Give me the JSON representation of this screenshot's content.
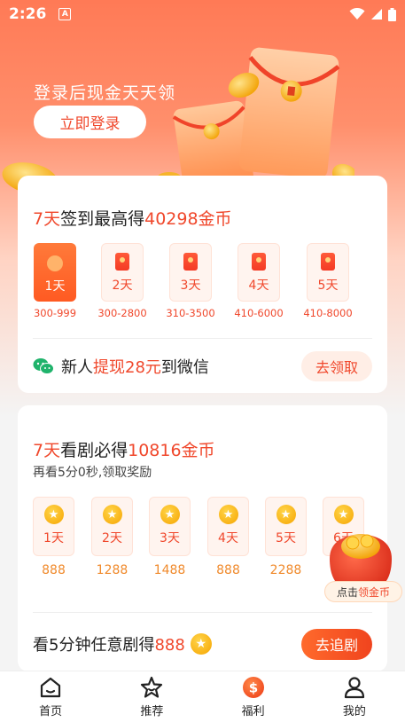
{
  "status": {
    "time": "2:26",
    "a_badge": "A"
  },
  "hero": {
    "text": "登录后现金天天领",
    "login_button": "立即登录"
  },
  "checkin": {
    "title_prefix": "7天",
    "title_mid": "签到最高得",
    "title_value": "40298金币",
    "days": [
      {
        "label": "1天",
        "range": "300-999",
        "active": true
      },
      {
        "label": "2天",
        "range": "300-2800",
        "active": false
      },
      {
        "label": "3天",
        "range": "310-3500",
        "active": false
      },
      {
        "label": "4天",
        "range": "410-6000",
        "active": false
      },
      {
        "label": "5天",
        "range": "410-8000",
        "active": false
      }
    ],
    "newuser_prefix": "新人",
    "newuser_highlight": "提现28元",
    "newuser_suffix": "到微信",
    "claim_button": "去领取"
  },
  "drama": {
    "title_prefix": "7天",
    "title_mid": "看剧必得",
    "title_value": "10816金币",
    "subtitle": "再看5分0秒,领取奖励",
    "days": [
      {
        "label": "1天",
        "value": "888"
      },
      {
        "label": "2天",
        "value": "1288"
      },
      {
        "label": "3天",
        "value": "1488"
      },
      {
        "label": "4天",
        "value": "888"
      },
      {
        "label": "5天",
        "value": "2288"
      },
      {
        "label": "6天",
        "value": ""
      }
    ],
    "watch_prefix": "看5分钟任意剧得",
    "watch_value": "888",
    "follow_button": "去追剧"
  },
  "float_badge": {
    "prefix": "点击",
    "highlight": "领金币"
  },
  "tabs": [
    {
      "label": "首页",
      "icon": "home-icon"
    },
    {
      "label": "推荐",
      "icon": "star-icon"
    },
    {
      "label": "福利",
      "icon": "dollar-icon",
      "active": true
    },
    {
      "label": "我的",
      "icon": "user-icon"
    }
  ],
  "colors": {
    "accent": "#f0482c",
    "gold": "#f6a400",
    "hero_top": "#ff7a56"
  }
}
